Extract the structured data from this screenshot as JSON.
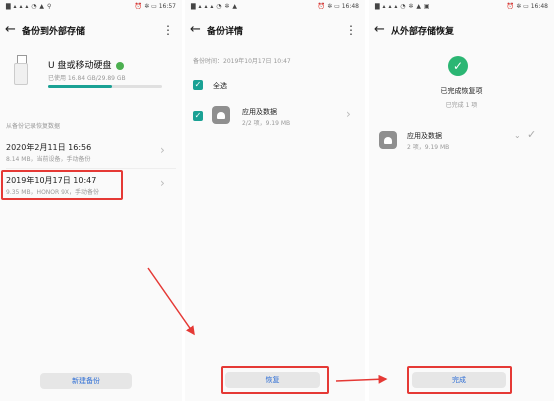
{
  "colors": {
    "accent": "#1aa194",
    "progress": "#1aa194",
    "annotation": "#e53935",
    "success": "#2bb673",
    "button_text": "#2f6fd6"
  },
  "panel1": {
    "status_left": "▇ ▴ ▴ ▴ ◔ ▲ ⚲",
    "status_right": "⏰ ✲ ▭ 16:57",
    "title": "备份到外部存储",
    "device_name": "U 盘或移动硬盘",
    "storage": "已使用 16.84 GB/29.89 GB",
    "storage_fraction": 0.56,
    "section": "从备份记录恢复数据",
    "records": [
      {
        "title": "2020年2月11日 16:56",
        "detail": "8.14 MB，当前设备，手动备份"
      },
      {
        "title": "2019年10月17日 10:47",
        "detail": "9.35 MB，HONOR 9X，手动备份"
      }
    ],
    "new_backup": "新建备份"
  },
  "panel2": {
    "status_left": "▇ ▴ ▴ ▴ ◔ ✲ ▲",
    "status_right": "⏰ ✲ ▭ 16:48",
    "title": "备份详情",
    "time": "备份时间：2019年10月17日 10:47",
    "select_all": "全选",
    "item_title": "应用及数据",
    "item_detail": "2/2 项，9.19 MB",
    "restore": "恢复"
  },
  "panel3": {
    "status_left": "▇ ▴ ▴ ▴ ◔ ✲ ▲ ▣",
    "status_right": "⏰ ✲ ▭ 16:48",
    "title": "从外部存储恢复",
    "done_title": "已完成恢复项",
    "done_count": "已完成 1 项",
    "item_title": "应用及数据",
    "item_detail": "2 项，9.19 MB",
    "finish": "完成"
  }
}
